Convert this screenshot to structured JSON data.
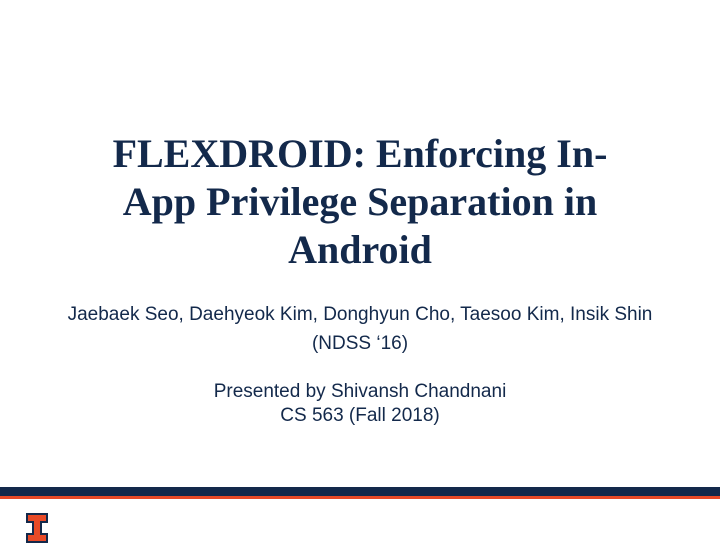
{
  "slide": {
    "title_line1": "FLEXDROID: Enforcing In-",
    "title_line2": "App Privilege Separation in",
    "title_line3": "Android",
    "authors": "Jaebaek Seo, Daehyeok Kim, Donghyun Cho, Taesoo Kim, Insik Shin",
    "venue": "(NDSS ‘16)",
    "presented_by": "Presented by Shivansh Chandnani",
    "course": "CS 563 (Fall 2018)"
  },
  "colors": {
    "navy": "#13294b",
    "orange": "#e84a27",
    "white": "#ffffff"
  },
  "logo": {
    "name": "illinois-block-i"
  }
}
